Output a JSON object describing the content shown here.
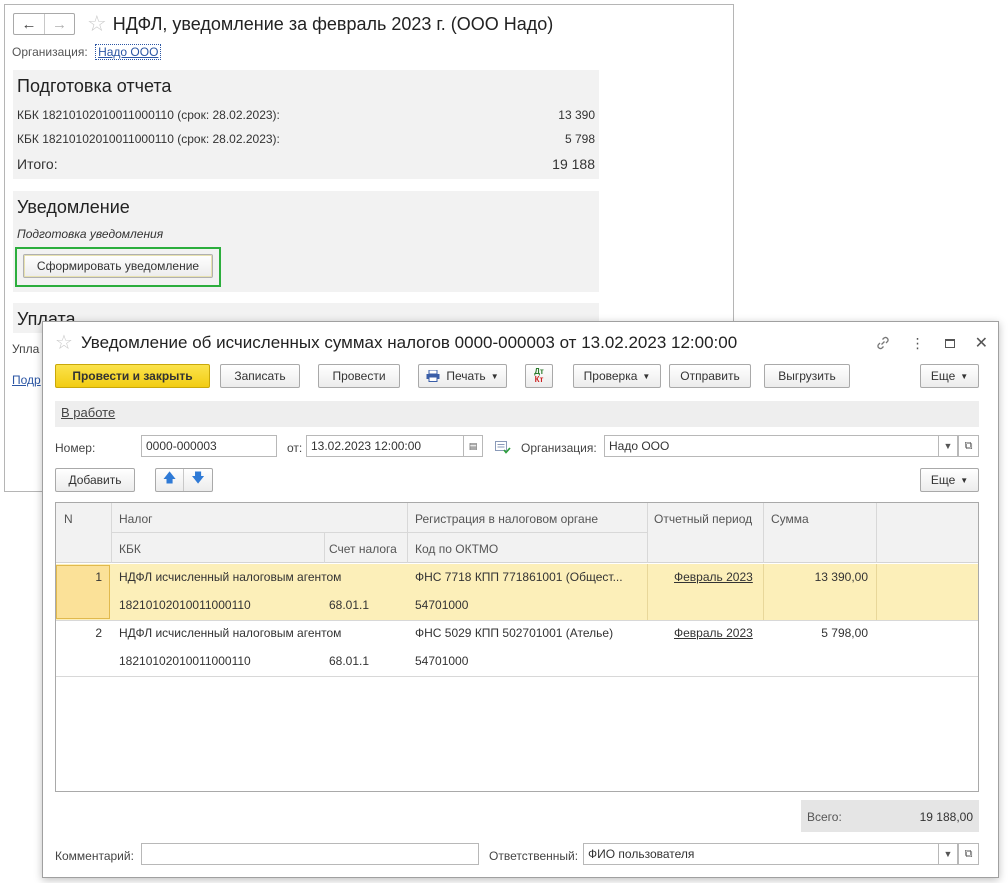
{
  "back_window": {
    "title": "НДФЛ, уведомление за февраль 2023 г. (ООО Надо)",
    "nav": {
      "back_icon": "arrow-left-icon",
      "forward_icon": "arrow-right-icon",
      "favorite_icon": "star-icon"
    },
    "org_label": "Организация:",
    "org_value": "Надо ООО",
    "report_section": {
      "title": "Подготовка отчета",
      "rows": [
        {
          "label": "КБК 18210102010011000110 (срок: 28.02.2023):",
          "value": "13 390"
        },
        {
          "label": "КБК 18210102010011000110 (срок: 28.02.2023):",
          "value": "5 798"
        }
      ],
      "total_label": "Итого:",
      "total_value": "19 188"
    },
    "notice_section": {
      "title": "Уведомление",
      "prep_label": "Подготовка уведомления",
      "button_label": "Сформировать уведомление"
    },
    "payment_section": {
      "title_partial": "Уплата",
      "text_partial": "Упла",
      "link_partial": "Подр"
    }
  },
  "front_window": {
    "title": "Уведомление об исчисленных суммах налогов 0000-000003 от 13.02.2023 12:00:00",
    "window_icons": [
      "link-icon",
      "more-icon",
      "maximize-icon",
      "close-icon"
    ],
    "toolbar": {
      "post_close": "Провести и закрыть",
      "save": "Записать",
      "post": "Провести",
      "print": "Печать",
      "dt_kt_top": "Дт",
      "dt_kt_bottom": "Кт",
      "check": "Проверка",
      "send": "Отправить",
      "export": "Выгрузить",
      "more": "Еще"
    },
    "status_link": "В работе",
    "fields": {
      "number_label": "Номер:",
      "number_value": "0000-000003",
      "date_label": "от:",
      "date_value": "13.02.2023 12:00:00",
      "org_label": "Организация:",
      "org_value": "Надо ООО"
    },
    "table_toolbar": {
      "add": "Добавить",
      "more": "Еще"
    },
    "table": {
      "headers": {
        "n": "N",
        "tax": "Налог",
        "kbk": "КБК",
        "account": "Счет налога",
        "registration": "Регистрация в налоговом органе",
        "oktmo": "Код по ОКТМО",
        "period": "Отчетный период",
        "sum": "Сумма"
      },
      "rows": [
        {
          "n": "1",
          "tax": "НДФЛ исчисленный налоговым агентом",
          "kbk": "18210102010011000110",
          "account": "68.01.1",
          "registration": "ФНС 7718 КПП 771861001 (Общест...",
          "oktmo": "54701000",
          "period": "Февраль 2023",
          "sum": "13 390,00"
        },
        {
          "n": "2",
          "tax": "НДФЛ исчисленный налоговым агентом",
          "kbk": "18210102010011000110",
          "account": "68.01.1",
          "registration": "ФНС 5029 КПП 502701001 (Ателье)",
          "oktmo": "54701000",
          "period": "Февраль 2023",
          "sum": "5 798,00"
        }
      ]
    },
    "total_label": "Всего:",
    "total_value": "19 188,00",
    "comment_label": "Комментарий:",
    "comment_value": "",
    "responsible_label": "Ответственный:",
    "responsible_value": "ФИО пользователя"
  }
}
